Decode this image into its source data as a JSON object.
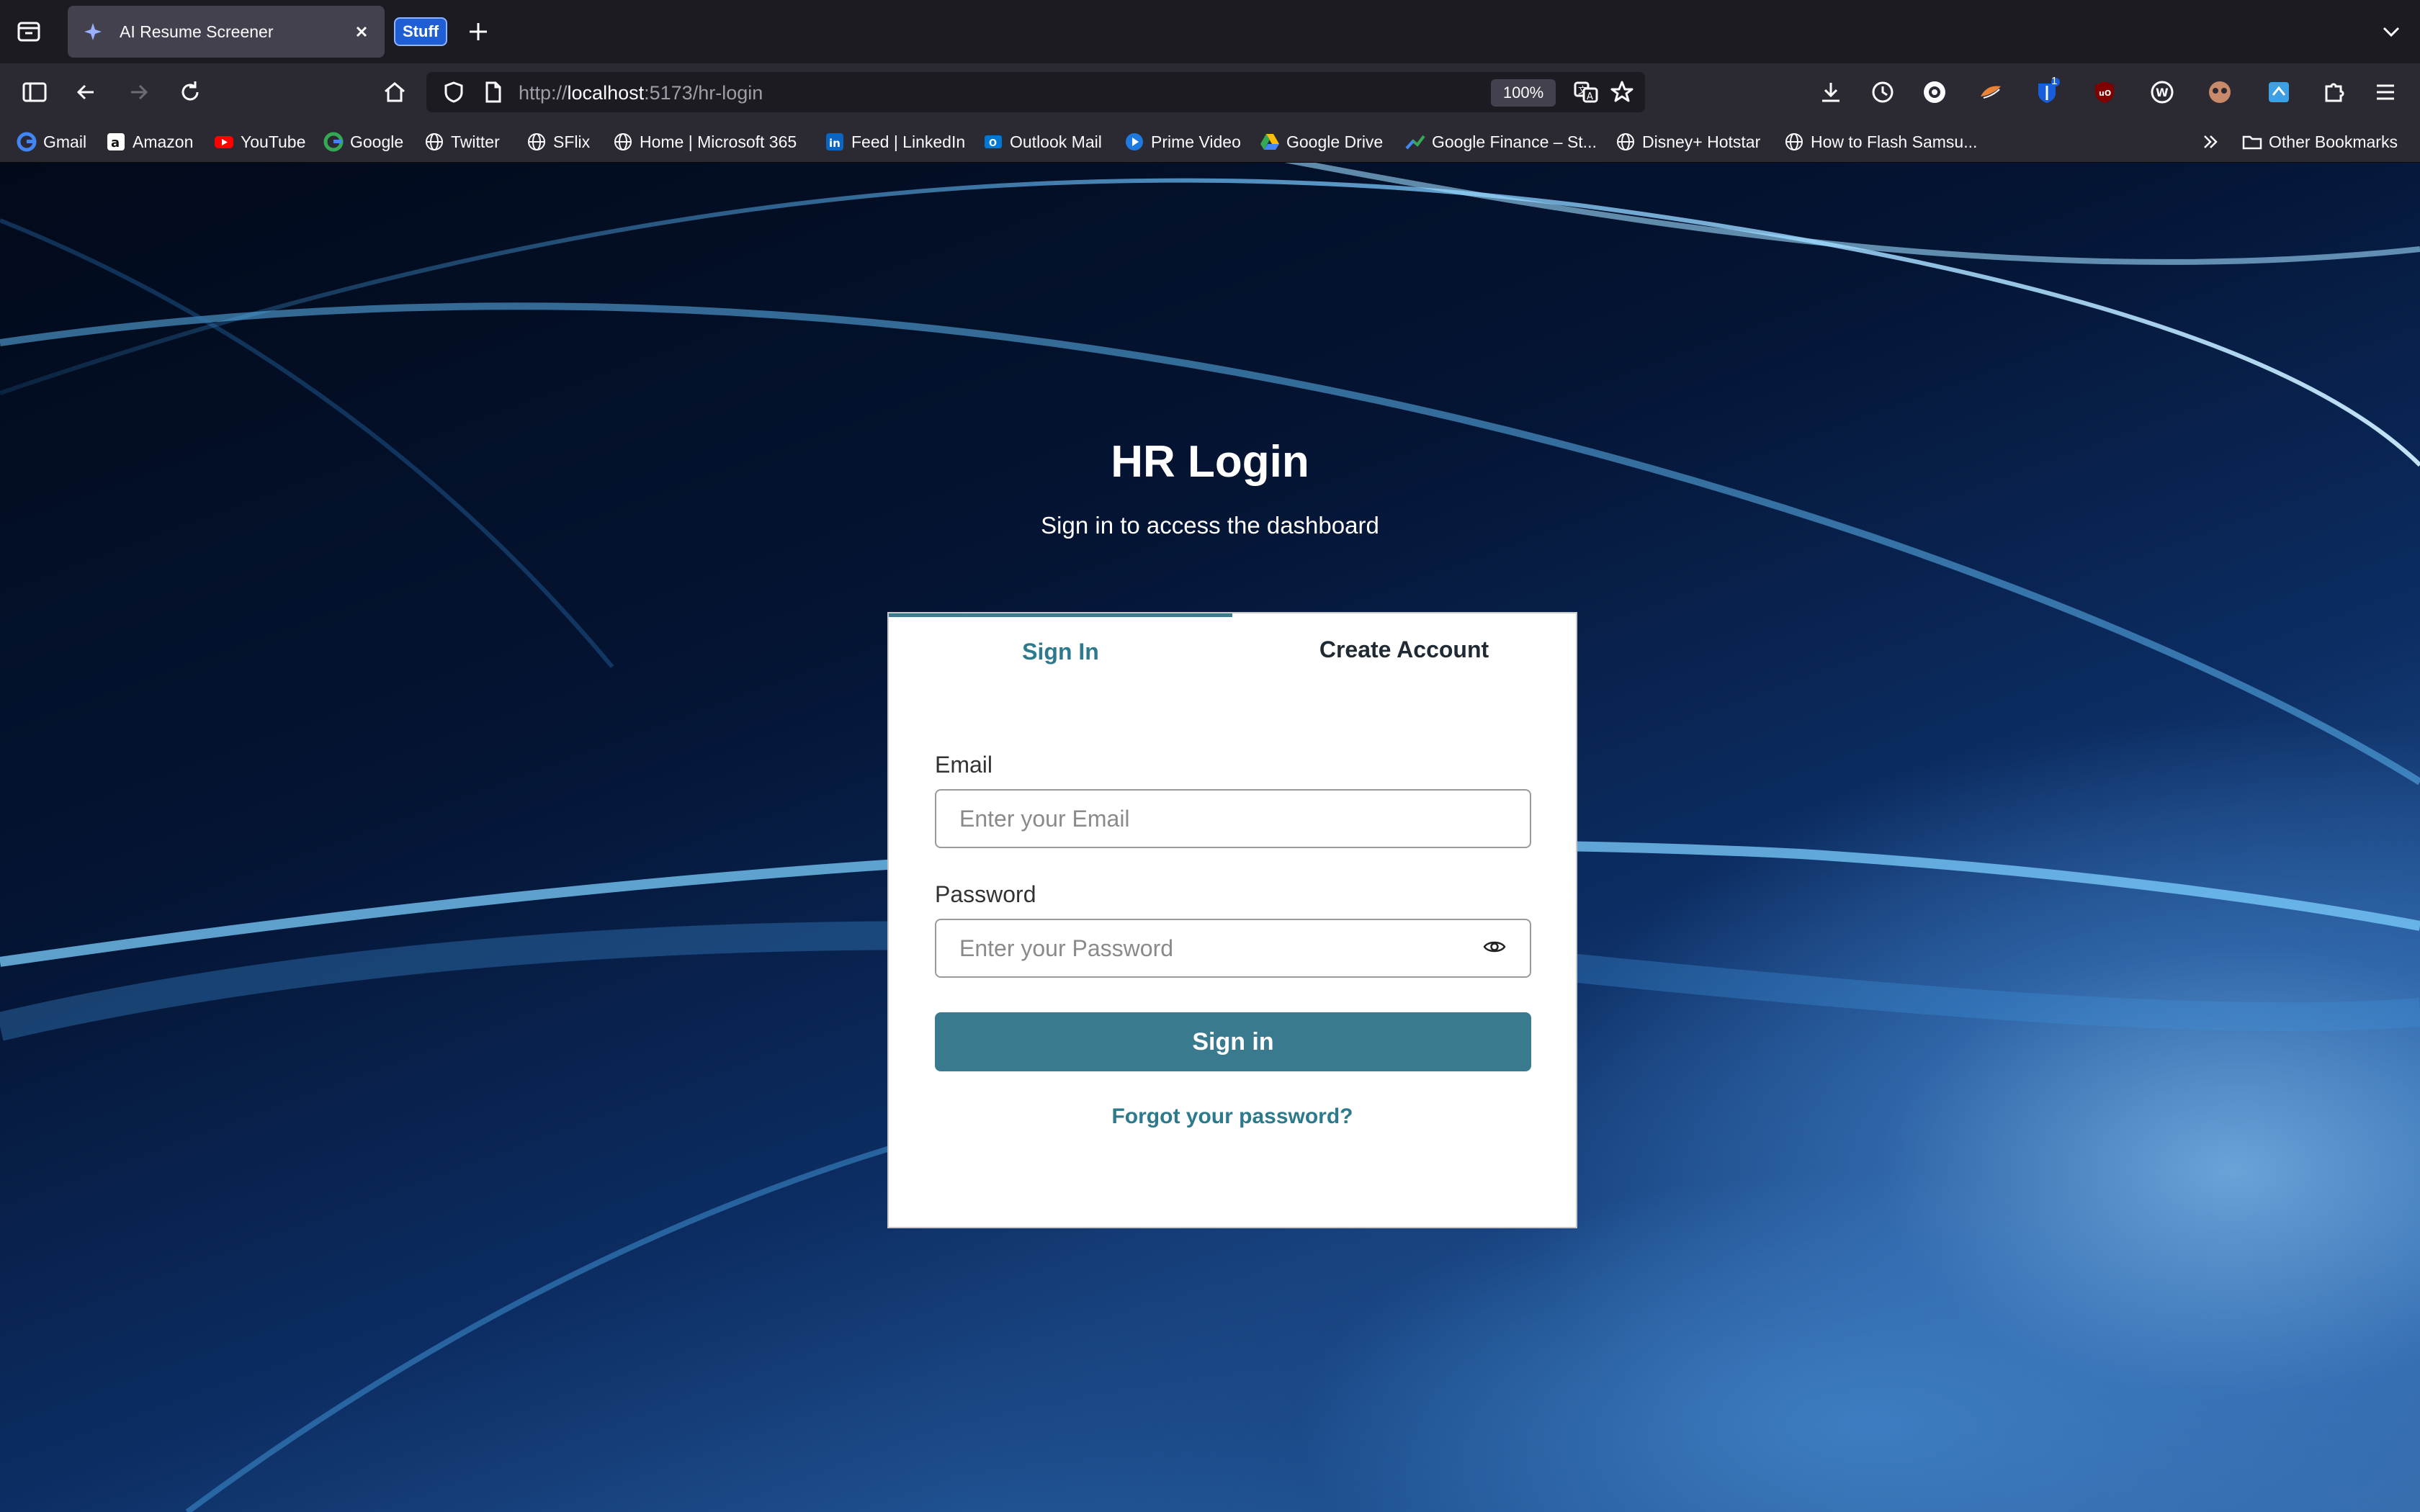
{
  "browser": {
    "tab": {
      "title": "AI Resume Screener"
    },
    "tab_group_label": "Stuff",
    "url": {
      "scheme": "http://",
      "host": "localhost",
      "rest": ":5173/hr-login"
    },
    "zoom": "100%",
    "toolbar_badge_count": "1"
  },
  "bookmarks": [
    {
      "label": "Gmail",
      "icon": "google-icon"
    },
    {
      "label": "Amazon",
      "icon": "amazon-icon"
    },
    {
      "label": "YouTube",
      "icon": "youtube-icon"
    },
    {
      "label": "Google",
      "icon": "google-icon"
    },
    {
      "label": "Twitter",
      "icon": "globe-icon"
    },
    {
      "label": "SFlix",
      "icon": "globe-icon"
    },
    {
      "label": "Home | Microsoft 365",
      "icon": "globe-icon"
    },
    {
      "label": "Feed | LinkedIn",
      "icon": "linkedin-icon"
    },
    {
      "label": "Outlook Mail",
      "icon": "outlook-icon"
    },
    {
      "label": "Prime Video",
      "icon": "prime-video-icon"
    },
    {
      "label": "Google Drive",
      "icon": "google-drive-icon"
    },
    {
      "label": "Google Finance – St...",
      "icon": "google-finance-icon"
    },
    {
      "label": "Disney+ Hotstar",
      "icon": "globe-icon"
    },
    {
      "label": "How to Flash Samsu...",
      "icon": "globe-icon"
    }
  ],
  "bookmarks_other": "Other Bookmarks",
  "page": {
    "title": "HR Login",
    "subtitle": "Sign in to access the dashboard",
    "tabs": {
      "sign_in": "Sign In",
      "create_account": "Create Account"
    },
    "email": {
      "label": "Email",
      "placeholder": "Enter your Email"
    },
    "password": {
      "label": "Password",
      "placeholder": "Enter your Password"
    },
    "submit_label": "Sign in",
    "forgot_label": "Forgot your password?"
  },
  "colors": {
    "accent": "#3a7a8f",
    "accent_text": "#2d7a8c",
    "chrome_bg": "#1c1b22",
    "toolbar_bg": "#2b2a33"
  }
}
